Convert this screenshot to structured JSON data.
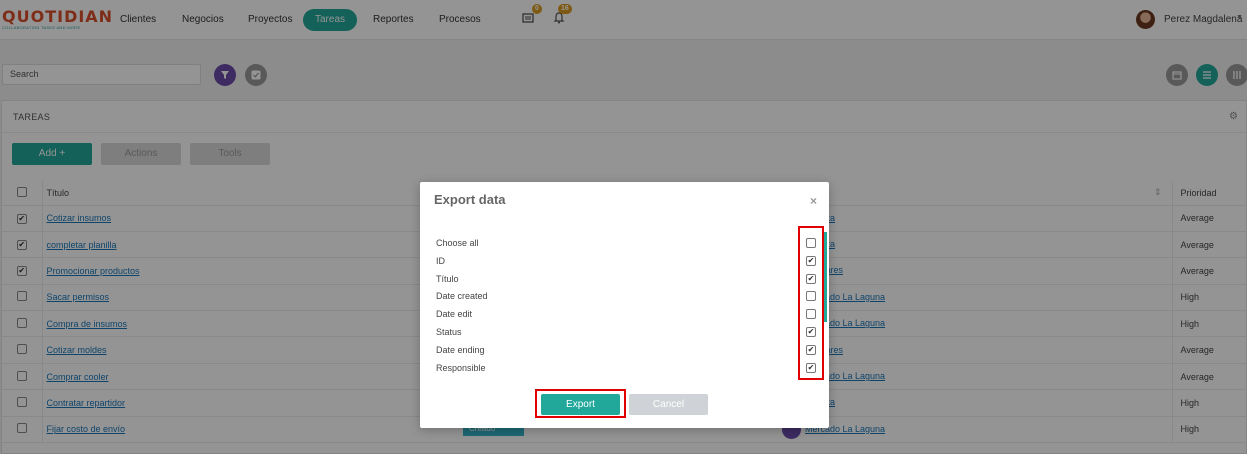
{
  "topbar": {
    "logo_text": "QUOTIDIAN",
    "logo_tagline": "COLLABORATION TASKS AND MORE",
    "nav": [
      {
        "label": "Clientes"
      },
      {
        "label": "Negocios"
      },
      {
        "label": "Proyectos"
      },
      {
        "label": "Tareas",
        "active": true
      },
      {
        "label": "Reportes"
      },
      {
        "label": "Procesos"
      }
    ],
    "messages_badge": "0",
    "notifications_badge": "16",
    "username": "Perez Magdalena"
  },
  "toolbar": {
    "search_value": "Search"
  },
  "panel": {
    "title": "TAREAS",
    "add_label": "Add +",
    "actions_label": "Actions",
    "tools_label": "Tools",
    "columns": {
      "title": "Título",
      "priority": "Prioridad"
    },
    "rows": [
      {
        "title": "Cotizar insumos",
        "checked": true,
        "status": "",
        "client": "Vendita",
        "priority": "Average"
      },
      {
        "title": "completar planilla",
        "checked": true,
        "status": "",
        "client": "Vendita",
        "priority": "Average"
      },
      {
        "title": "Promocionar productos",
        "checked": true,
        "status": "",
        "client": "Celulares",
        "priority": "Average"
      },
      {
        "title": "Sacar permisos",
        "checked": false,
        "status": "",
        "client": "Mercado La Laguna",
        "priority": "High"
      },
      {
        "title": "Compra de insumos",
        "checked": false,
        "status": "",
        "client": "Mercado La Laguna",
        "priority": "High"
      },
      {
        "title": "Cotizar moldes",
        "checked": false,
        "status": "",
        "client": "Celulares",
        "priority": "Average"
      },
      {
        "title": "Comprar cooler",
        "checked": false,
        "status": "",
        "client": "Mercado La Laguna",
        "priority": "Average"
      },
      {
        "title": "Contratar repartidor",
        "checked": false,
        "status": "",
        "client": "Vendita",
        "priority": "High"
      },
      {
        "title": "Fijar costo de envío",
        "checked": false,
        "status": "Creado",
        "client": "Mercado La Laguna",
        "priority": "High"
      }
    ]
  },
  "modal": {
    "title": "Export data",
    "close_icon": "×",
    "fields": [
      {
        "label": "Choose all",
        "checked": false
      },
      {
        "label": "ID",
        "checked": true
      },
      {
        "label": "Título",
        "checked": true
      },
      {
        "label": "Date created",
        "checked": false
      },
      {
        "label": "Date edit",
        "checked": false
      },
      {
        "label": "Status",
        "checked": true
      },
      {
        "label": "Date ending",
        "checked": true
      },
      {
        "label": "Responsible",
        "checked": true
      }
    ],
    "export_label": "Export",
    "cancel_label": "Cancel"
  },
  "colors": {
    "accent": "#21a89a",
    "filter_purple": "#6a4aa8",
    "highlight_red": "#e00000",
    "badge_orange": "#d99a1e"
  }
}
